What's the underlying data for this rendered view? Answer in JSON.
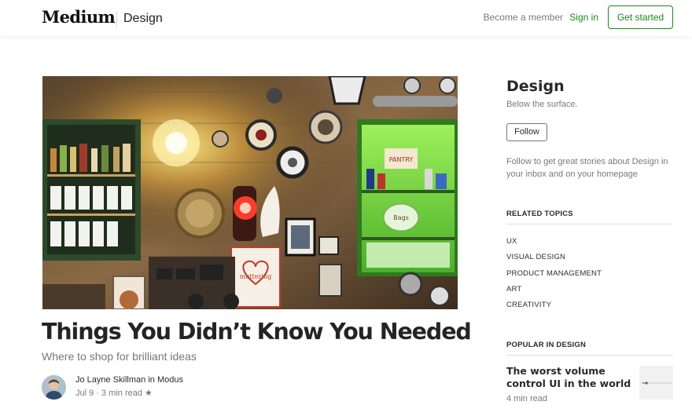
{
  "header": {
    "logo": "Medium",
    "section": "Design",
    "become_member": "Become a member",
    "sign_in": "Sign in",
    "get_started": "Get started"
  },
  "article": {
    "title": "Things You Didn’t Know You Needed",
    "subtitle": "Where to shop for brilliant ideas",
    "author_line": "Jo Layne Skillman in Modus",
    "meta": "Jul 9 · 3 min read ★",
    "hero_signs": {
      "pantry": "PANTRY",
      "bags": "Bags",
      "heart": "muttering"
    }
  },
  "sidebar": {
    "title": "Design",
    "tagline": "Below the surface.",
    "follow": "Follow",
    "follow_desc": "Follow to get great stories about Design in your inbox and on your homepage",
    "related_heading": "RELATED TOPICS",
    "topics": [
      "UX",
      "VISUAL DESIGN",
      "PRODUCT MANAGEMENT",
      "ART",
      "CREATIVITY"
    ],
    "popular_heading": "POPULAR IN DESIGN",
    "popular": {
      "title": "The worst volume control UI in the world",
      "meta": "4 min read"
    }
  },
  "colors": {
    "brand_green": "#1a8917",
    "text_primary": "#1f1f1f",
    "text_secondary": "#757575"
  },
  "icons": [
    "star-icon",
    "avatar-image",
    "hero-image"
  ]
}
